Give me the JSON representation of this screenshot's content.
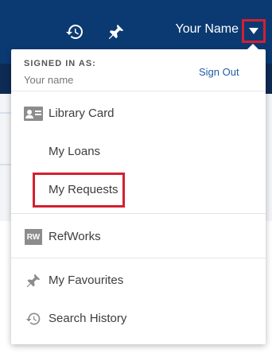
{
  "header": {
    "user_name": "Your Name",
    "icons": {
      "history": "history-icon",
      "pin": "pin-icon",
      "caret": "caret-down-icon"
    }
  },
  "menu": {
    "signed_in_label": "SIGNED IN AS:",
    "signed_in_name": "Your name",
    "sign_out": "Sign Out",
    "items": [
      {
        "label": "Library Card",
        "icon": "library-card-icon"
      },
      {
        "label": "My Loans",
        "icon": ""
      },
      {
        "label": "My Requests",
        "icon": ""
      },
      {
        "label": "RefWorks",
        "icon": "refworks-icon",
        "badge": "RW"
      },
      {
        "label": "My Favourites",
        "icon": "pin-icon"
      },
      {
        "label": "Search History",
        "icon": "history-icon"
      }
    ]
  },
  "colors": {
    "header_bg": "#0b3a72",
    "link": "#1f5aa6",
    "highlight": "#d32030"
  }
}
